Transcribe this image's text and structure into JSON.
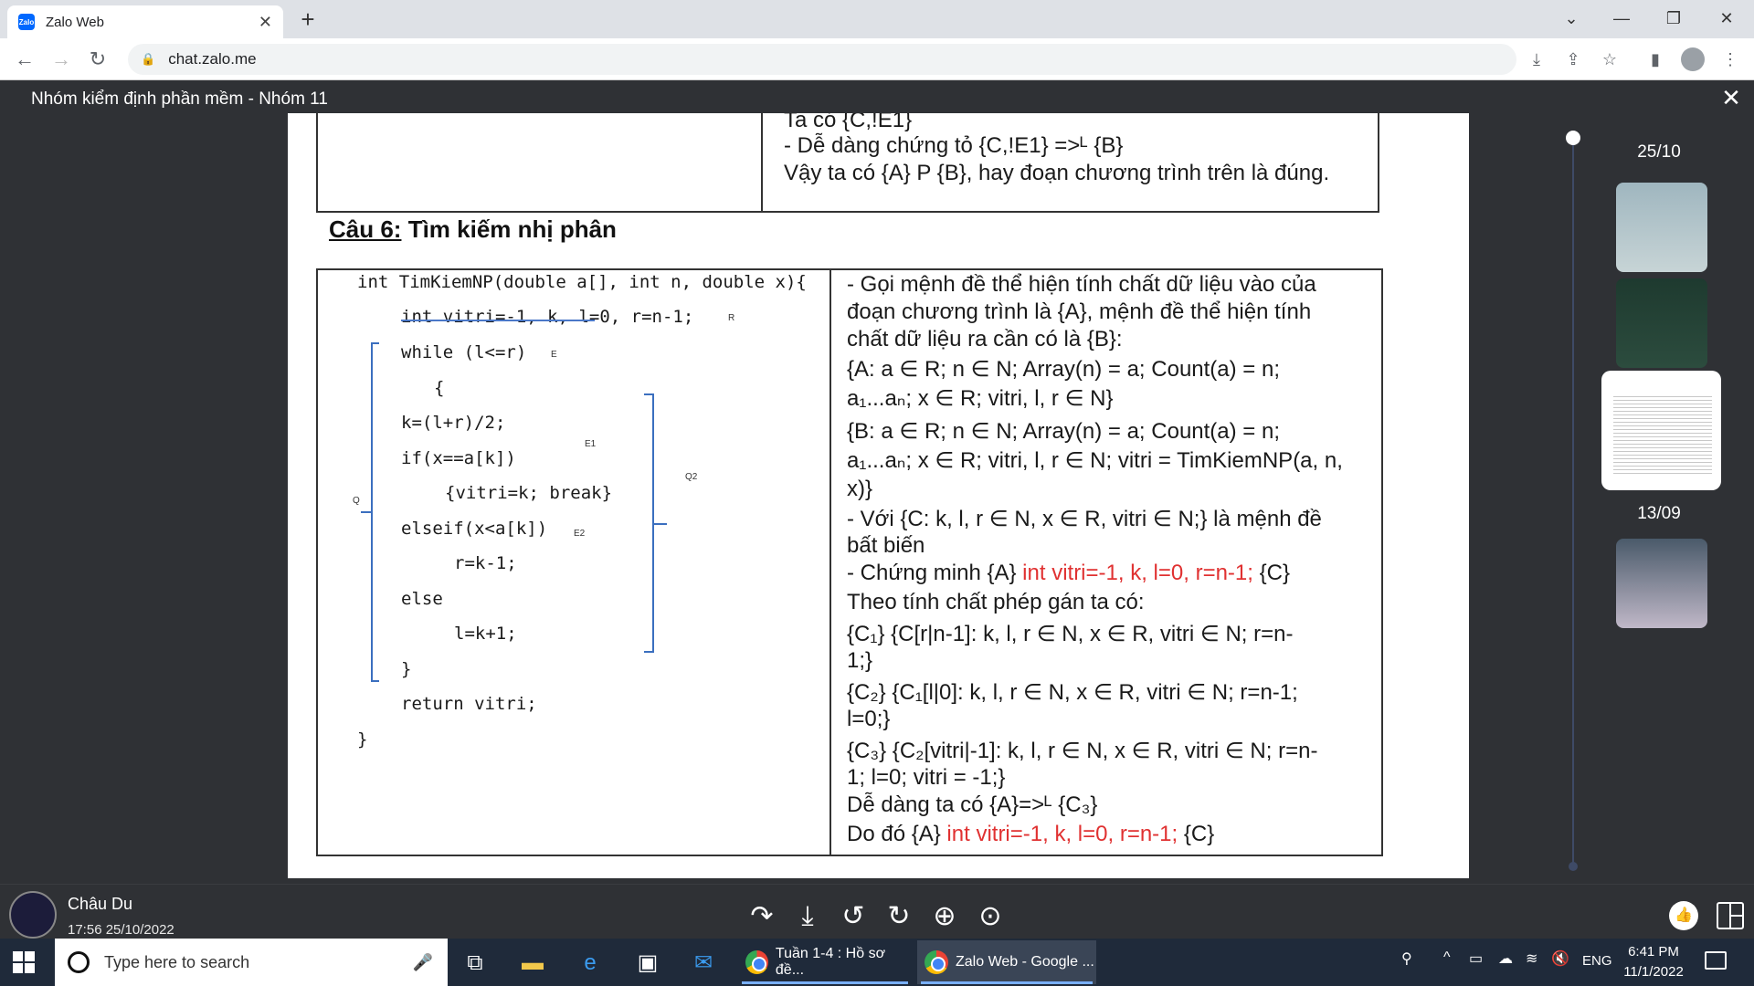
{
  "browser": {
    "tab_title": "Zalo Web",
    "favicon_text": "Zalo",
    "tab_close": "✕",
    "new_tab": "+",
    "url": "chat.zalo.me"
  },
  "viewer": {
    "title": "Nhóm kiểm định phần mềm - Nhóm 11",
    "close": "✕"
  },
  "doc": {
    "top_lines": [
      "Ta có {C,!E1}",
      "- Dễ dàng chứng tỏ {C,!E1} =>ᴸ {B}",
      "Vậy ta có {A} P {B}, hay đoạn chương trình trên là đúng."
    ],
    "heading_prefix": "Câu 6:",
    "heading_rest": " Tìm kiếm nhị phân",
    "code": [
      "int TimKiemNP(double a[], int n, double x){",
      "int vitri=-1, k, l=0, r=n-1;",
      "while (l<=r)",
      "{",
      "k=(l+r)/2;",
      "if(x==a[k])",
      "{vitri=k; break}",
      "elseif(x<a[k])",
      "r=k-1;",
      "else",
      "l=k+1;",
      "}",
      "return vitri;",
      "}"
    ],
    "marks": {
      "R": "R",
      "E": "E",
      "E1": "E1",
      "E2": "E2",
      "Q": "Q",
      "Q2": "Q2"
    },
    "proof": [
      "- Gọi mệnh đề thể hiện tính chất dữ liệu vào của",
      "đoạn chương trình là {A}, mệnh đề thể hiện tính",
      "chất dữ liệu ra cần có là {B}:",
      "{A: a ∈ R; n ∈ N; Array(n) = a; Count(a) = n;",
      "a₁...aₙ; x ∈ R; vitri, l, r ∈ N}",
      "{B: a ∈ R; n ∈ N; Array(n) = a; Count(a) = n;",
      "a₁...aₙ; x ∈ R; vitri, l, r ∈ N; vitri = TimKiemNP(a, n,",
      "x)}",
      "- Với {C: k, l, r ∈ N, x ∈ R, vitri ∈ N;} là mệnh đề",
      "bất biến"
    ],
    "proof_chung_prefix": "- Chứng minh {A}",
    "proof_red": "int vitri=-1, k, l=0, r=n-1;",
    "proof_suffix": "{C}",
    "proof2": [
      "Theo tính chất phép gán ta có:",
      "{C₁}     {C[r|n-1]: k, l, r ∈ N, x ∈ R, vitri ∈ N; r=n-",
      "1;}",
      "{C₂}     {C₁[l|0]: k, l, r ∈ N, x ∈ R, vitri ∈ N; r=n-1;",
      "l=0;}",
      "{C₃}     {C₂[vitri|-1]: k, l, r ∈ N, x ∈ R, vitri ∈ N; r=n-",
      "1; l=0; vitri = -1;}",
      "Dễ dàng ta có {A}=>ᴸ {C₃}"
    ],
    "proof_do_prefix": "Do đó {A}"
  },
  "sidebar": {
    "date1": "25/10",
    "date2": "13/09"
  },
  "sender": {
    "name": "Châu Du",
    "time": "17:56 25/10/2022"
  },
  "toolbar_icons": [
    "share-icon",
    "download-icon",
    "rotate-left-icon",
    "rotate-right-icon",
    "zoom-in-icon",
    "actual-size-icon"
  ],
  "taskbar": {
    "search_placeholder": "Type here to search",
    "app1": "Tuần 1-4 : Hồ sơ đề...",
    "app2": "Zalo Web - Google ...",
    "lang": "ENG",
    "time": "6:41 PM",
    "date": "11/1/2022"
  },
  "colors": {
    "accent_red": "#e03131",
    "viewer_bg": "#2f3135",
    "taskbar_bg": "#1f2a3a"
  }
}
